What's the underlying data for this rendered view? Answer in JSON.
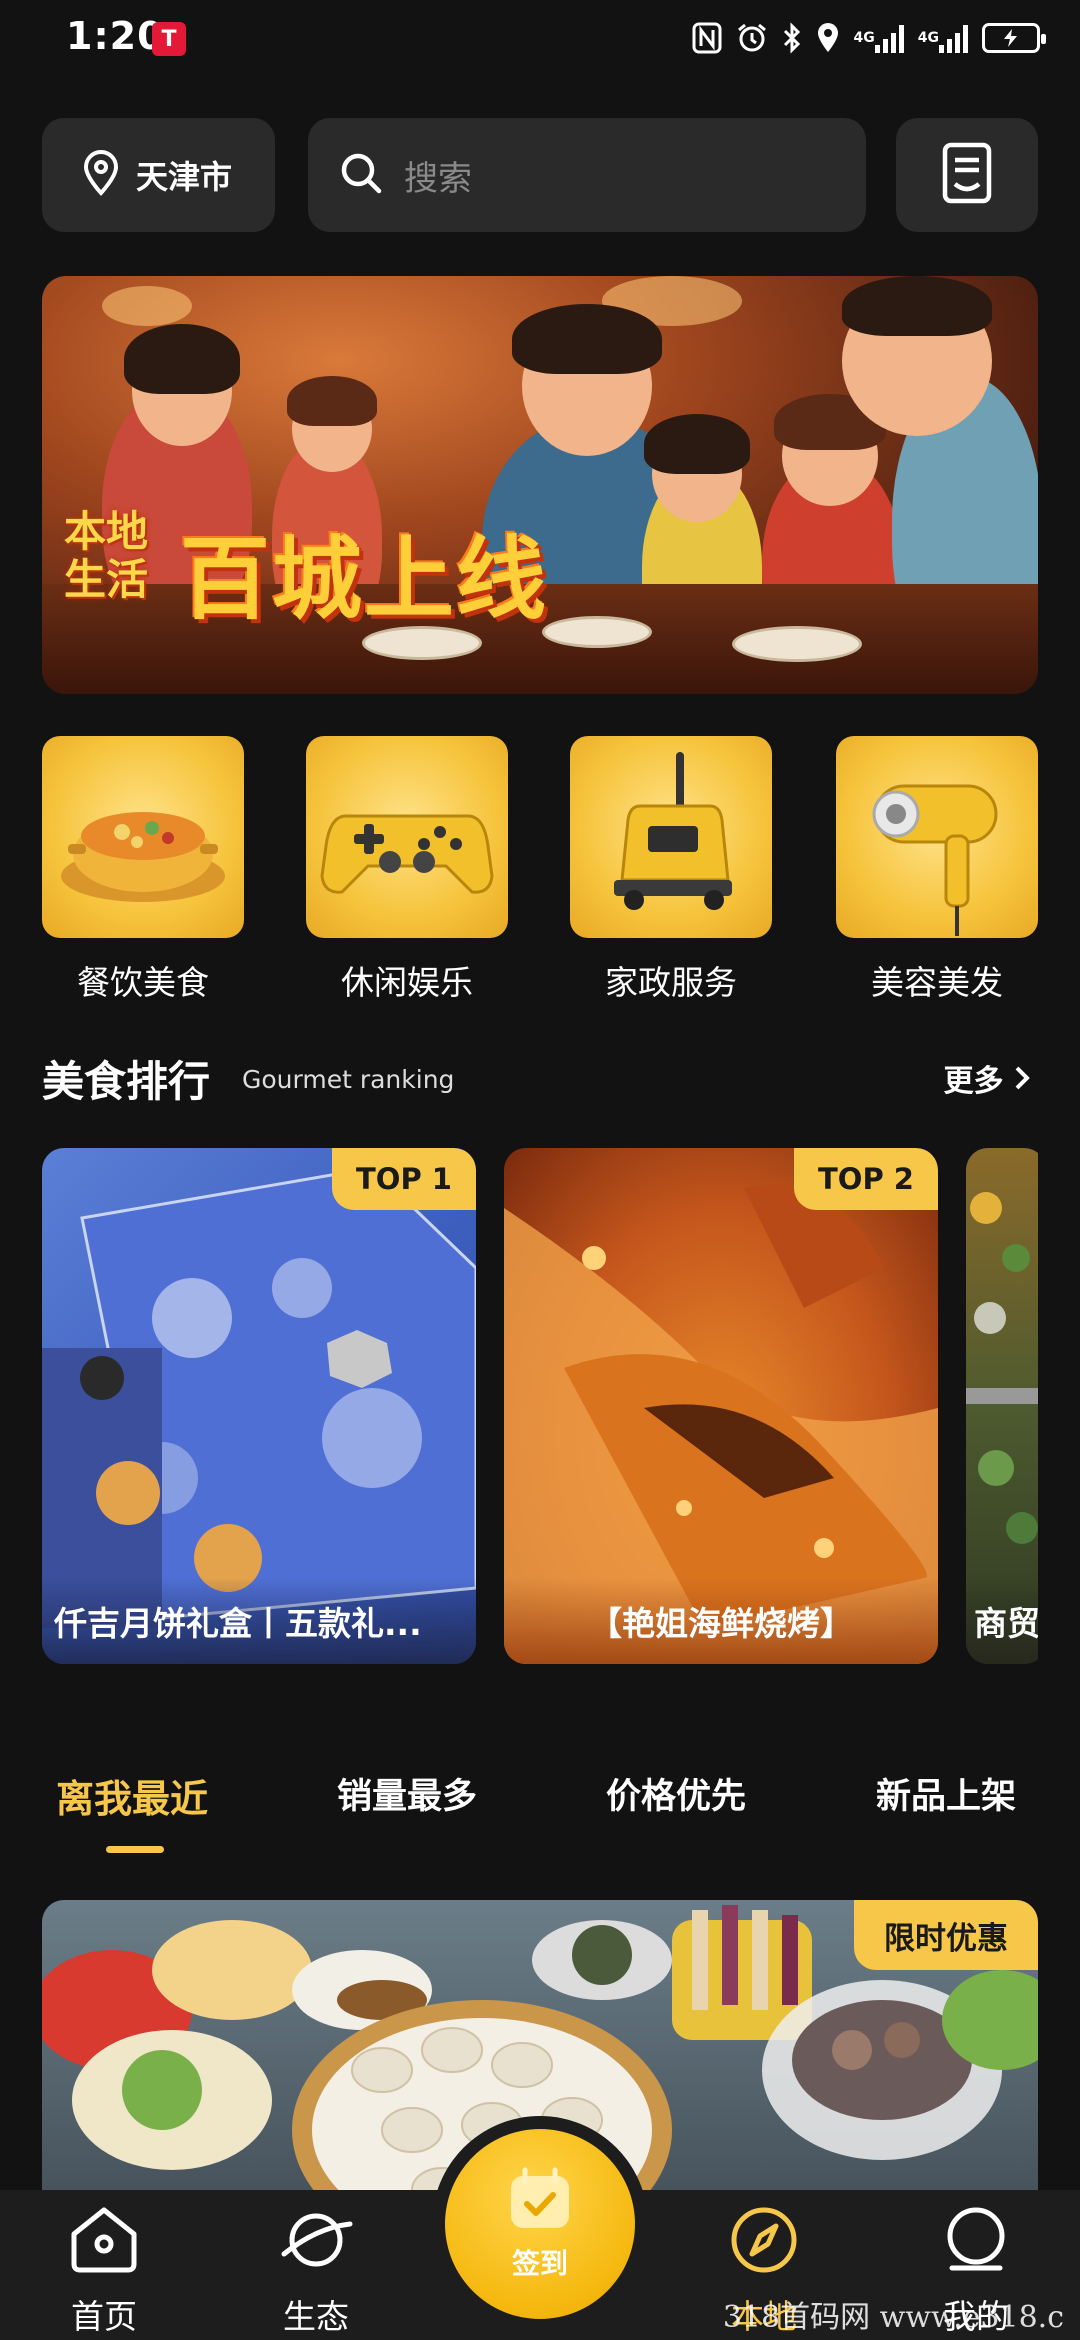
{
  "status_bar": {
    "time": "1:20",
    "app_badge": "T",
    "net_label_1": "4G",
    "net_label_2": "4G",
    "icons": [
      "nfc-icon",
      "alarm-icon",
      "bluetooth-icon",
      "location-icon",
      "signal-icon",
      "signal-icon",
      "battery-charging-icon"
    ]
  },
  "top_bar": {
    "location": "天津市",
    "search_placeholder": "搜索"
  },
  "banner": {
    "tag": "本地生活",
    "title": "百城上线"
  },
  "categories": [
    {
      "label": "餐饮美食",
      "icon": "hotpot-icon"
    },
    {
      "label": "休闲娱乐",
      "icon": "gamepad-icon"
    },
    {
      "label": "家政服务",
      "icon": "vacuum-icon"
    },
    {
      "label": "美容美发",
      "icon": "hairdryer-icon"
    }
  ],
  "ranking": {
    "title": "美食排行",
    "subtitle": "Gourmet ranking",
    "more": "更多",
    "items": [
      {
        "badge": "TOP 1",
        "caption": "仟吉月饼礼盒丨五款礼..."
      },
      {
        "badge": "TOP 2",
        "caption": "【艳姐海鲜烧烤】"
      },
      {
        "badge": "",
        "caption": "商贸"
      }
    ]
  },
  "tabs": [
    "离我最近",
    "销量最多",
    "价格优先",
    "新品上架"
  ],
  "active_tab": "离我最近",
  "feed": {
    "promo_badge": "限时优惠"
  },
  "bottom_nav": {
    "items": [
      "首页",
      "生态",
      "本地",
      "我的"
    ],
    "checkin": "签到",
    "active": "本地"
  },
  "watermark": "318首码网 www.e318.c",
  "colors": {
    "background": "#121212",
    "surface": "#2a2a2a",
    "accent": "#f7c74a",
    "nav_background": "#1d1d1d"
  }
}
